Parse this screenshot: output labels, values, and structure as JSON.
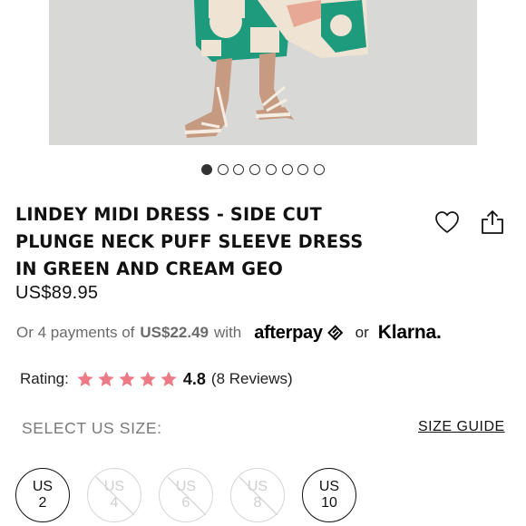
{
  "product": {
    "title_line1": "LINDEY MIDI DRESS - SIDE CUT",
    "title_line2": "PLUNGE NECK PUFF SLEEVE DRESS",
    "title_line3": "IN GREEN AND CREAM GEO",
    "price": "US$89.95"
  },
  "carousel": {
    "total_dots": 8,
    "active_index": 0
  },
  "payments": {
    "prefix": "Or 4 payments of",
    "amount": "US$22.49",
    "with": "with",
    "afterpay_label": "afterpay",
    "or": "or",
    "klarna_label": "Klarna."
  },
  "rating": {
    "label": "Rating:",
    "value": "4.8",
    "reviews": "(8 Reviews)",
    "stars": 5,
    "star_color": "#ee7a86"
  },
  "size_selector": {
    "label": "SELECT US SIZE:",
    "guide_label": "SIZE GUIDE",
    "sizes": [
      {
        "region": "US",
        "value": "2",
        "available": true
      },
      {
        "region": "US",
        "value": "4",
        "available": false
      },
      {
        "region": "US",
        "value": "6",
        "available": false
      },
      {
        "region": "US",
        "value": "8",
        "available": false
      },
      {
        "region": "US",
        "value": "10",
        "available": true
      }
    ]
  },
  "icons": {
    "wishlist": "heart-icon",
    "share": "share-icon"
  },
  "colors": {
    "dress_green": "#1e9a7c",
    "dress_cream": "#efe3d4",
    "background_grey": "#d9d9d9"
  }
}
